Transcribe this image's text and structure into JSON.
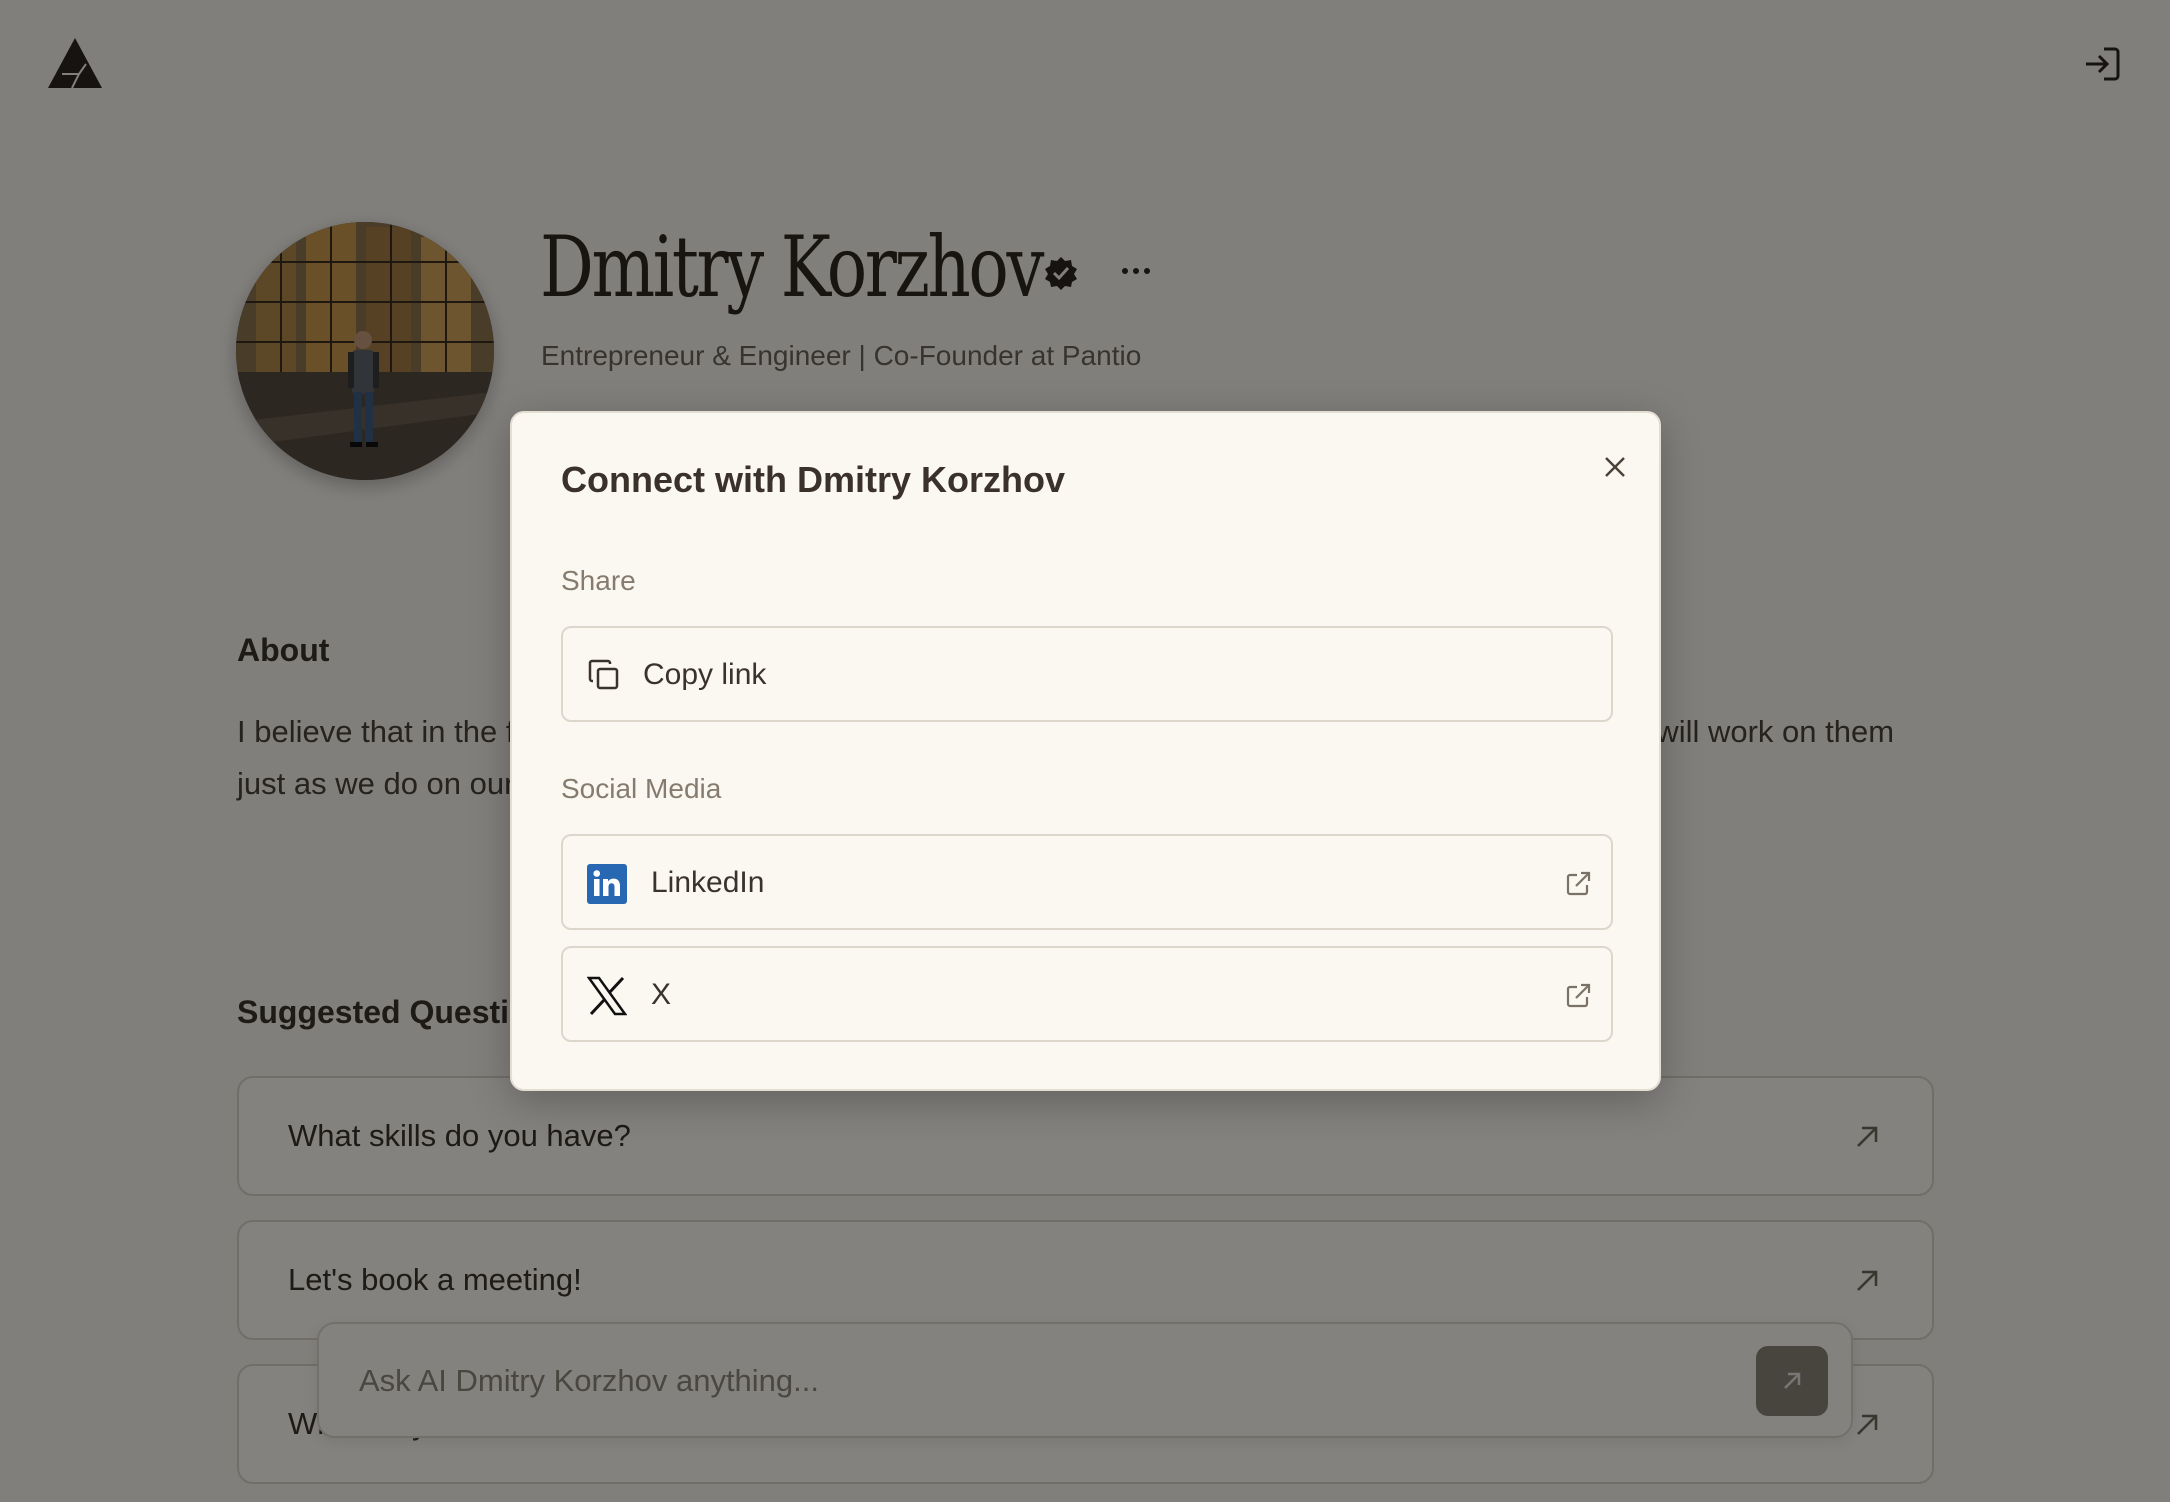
{
  "header": {
    "logo_icon": "triangle-logo-icon",
    "login_icon": "sign-in-icon"
  },
  "profile": {
    "name": "Dmitry Korzhov",
    "subtitle": "Entrepreneur & Engineer | Co-Founder at Pantio",
    "verified_icon": "verified-badge-icon",
    "more_icon": "more-horizontal-icon"
  },
  "about": {
    "heading": "About",
    "text": "I believe that in the future, AI personas will earn money, communicate with people, and grow — and we will work on them just as we do on ourselves."
  },
  "suggested": {
    "heading": "Suggested Questions",
    "questions": [
      {
        "text": "What skills do you have?"
      },
      {
        "text": "Let's book a meeting!"
      },
      {
        "text": "What do you do?"
      }
    ]
  },
  "chat": {
    "placeholder": "Ask AI Dmitry Korzhov anything..."
  },
  "modal": {
    "title": "Connect with Dmitry Korzhov",
    "share_label": "Share",
    "copy_link": "Copy link",
    "social_label": "Social Media",
    "social": [
      {
        "label": "LinkedIn",
        "icon": "linkedin-icon",
        "color": "#2867b2"
      },
      {
        "label": "X",
        "icon": "x-logo-icon",
        "color": "#111111"
      }
    ]
  },
  "colors": {
    "background": "#f7f4ee",
    "modal_bg": "#fbf8f1",
    "text": "#3a332b",
    "overlay": "rgba(0,0,0,0.48)"
  }
}
